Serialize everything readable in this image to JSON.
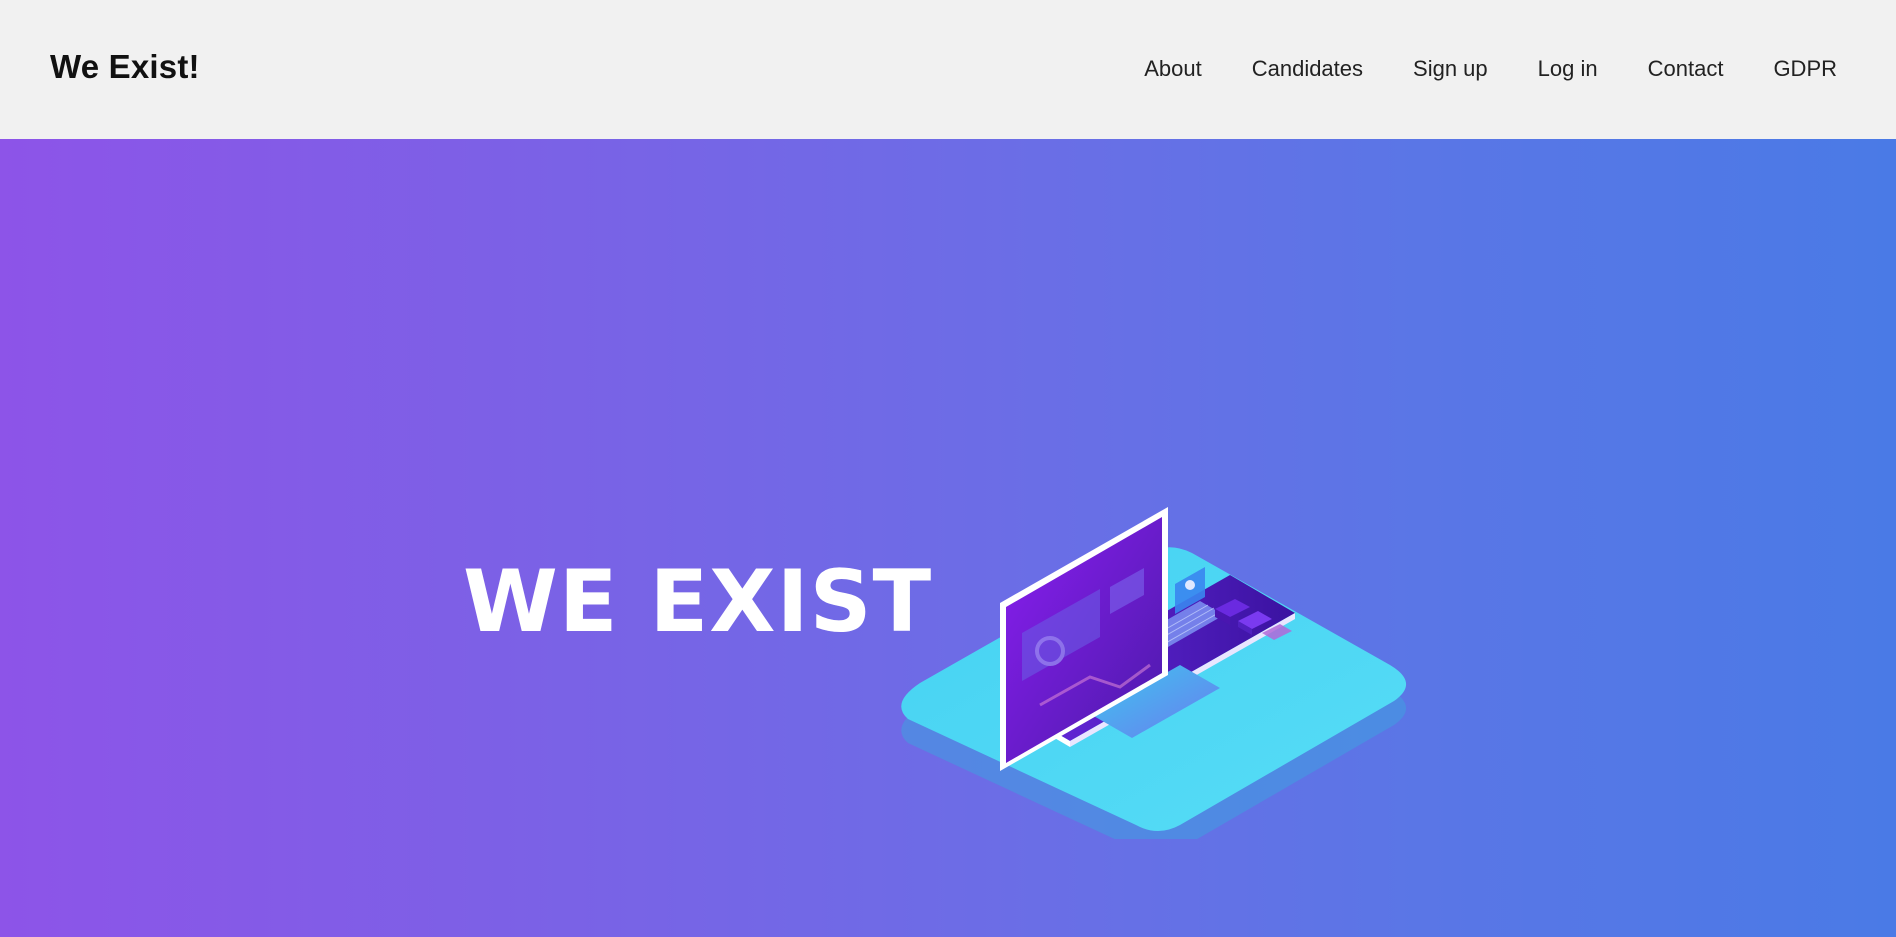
{
  "header": {
    "brand": "We Exist!",
    "nav": [
      {
        "label": "About"
      },
      {
        "label": "Candidates"
      },
      {
        "label": "Sign up"
      },
      {
        "label": "Log in"
      },
      {
        "label": "Contact"
      },
      {
        "label": "GDPR"
      }
    ]
  },
  "hero": {
    "title": "WE EXIST",
    "illustration": "isometric-laptop-illustration"
  },
  "colors": {
    "header_bg": "#f1f1f1",
    "gradient_start": "#8d54e8",
    "gradient_end": "#4a7ae6",
    "platform": "#4fd6f2",
    "laptop_body": "#5a1ed8"
  }
}
